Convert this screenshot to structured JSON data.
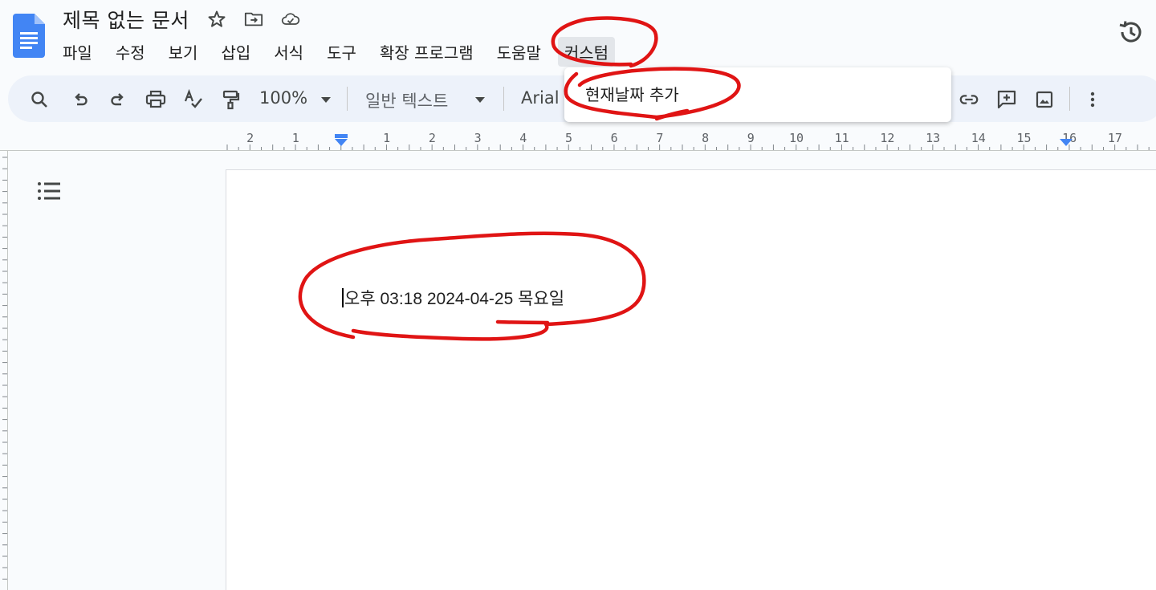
{
  "document": {
    "title": "제목 없는 문서",
    "body_text": "오후 03:18 2024-04-25 목요일"
  },
  "menubar": {
    "items": [
      "파일",
      "수정",
      "보기",
      "삽입",
      "서식",
      "도구",
      "확장 프로그램",
      "도움말",
      "커스텀"
    ],
    "active": "커스텀"
  },
  "toolbar": {
    "zoom": "100%",
    "style": "일반 텍스트",
    "font": "Arial"
  },
  "dropdown": {
    "items": [
      "현재날짜 추가"
    ]
  },
  "ruler": {
    "labels": [
      "2",
      "1",
      "1",
      "2",
      "3",
      "4",
      "5",
      "6",
      "7",
      "8",
      "9",
      "10",
      "11",
      "12",
      "13",
      "14",
      "15",
      "16",
      "17"
    ]
  },
  "colors": {
    "annotation": "#e01414",
    "accent_blue": "#4285f4",
    "toolbar_bg": "#edf2fa"
  }
}
